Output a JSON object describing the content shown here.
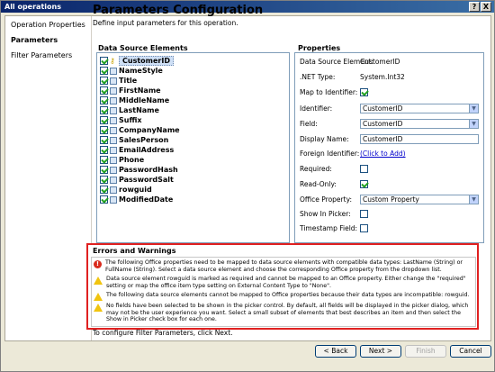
{
  "window": {
    "title": "All operations",
    "help_label": "?",
    "close_label": "X"
  },
  "sidebar": {
    "items": [
      {
        "label": "Operation Properties"
      },
      {
        "label": "Parameters"
      },
      {
        "label": "Filter Parameters"
      }
    ]
  },
  "page": {
    "title": "Parameters Configuration",
    "description": "Define input parameters for this operation."
  },
  "data_source": {
    "label": "Data Source Elements",
    "items": [
      {
        "name": "CustomerID",
        "checked": true,
        "key": true
      },
      {
        "name": "NameStyle",
        "checked": true
      },
      {
        "name": "Title",
        "checked": true
      },
      {
        "name": "FirstName",
        "checked": true
      },
      {
        "name": "MiddleName",
        "checked": true
      },
      {
        "name": "LastName",
        "checked": true
      },
      {
        "name": "Suffix",
        "checked": true
      },
      {
        "name": "CompanyName",
        "checked": true
      },
      {
        "name": "SalesPerson",
        "checked": true
      },
      {
        "name": "EmailAddress",
        "checked": true
      },
      {
        "name": "Phone",
        "checked": true
      },
      {
        "name": "PasswordHash",
        "checked": true
      },
      {
        "name": "PasswordSalt",
        "checked": true
      },
      {
        "name": "rowguid",
        "checked": true
      },
      {
        "name": "ModifiedDate",
        "checked": true
      }
    ]
  },
  "properties": {
    "label": "Properties",
    "data_source_element_label": "Data Source Element:",
    "data_source_element_value": "CustomerID",
    "net_type_label": ".NET Type:",
    "net_type_value": "System.Int32",
    "map_to_identifier_label": "Map to Identifier:",
    "identifier_label": "Identifier:",
    "identifier_value": "CustomerID",
    "field_label": "Field:",
    "field_value": "CustomerID",
    "display_name_label": "Display Name:",
    "display_name_value": "CustomerID",
    "foreign_identifier_label": "Foreign Identifier:",
    "foreign_identifier_link": "(Click to Add)",
    "required_label": "Required:",
    "read_only_label": "Read-Only:",
    "office_property_label": "Office Property:",
    "office_property_value": "Custom Property",
    "show_in_picker_label": "Show In Picker:",
    "timestamp_field_label": "Timestamp Field:"
  },
  "errors": {
    "title": "Errors and Warnings",
    "items": [
      {
        "type": "error",
        "text": "The following Office properties need to be mapped to data source elements with compatible data types: LastName (String) or FullName (String). Select a data source element and choose the corresponding Office property from the dropdown list."
      },
      {
        "type": "warning",
        "text": "Data source element rowguid is marked as required and cannot be mapped to an Office property. Either change the \"required\" setting or map the office item type setting on External Content Type to \"None\"."
      },
      {
        "type": "warning",
        "text": "The following data source elements cannot be mapped to Office properties because their data types are incompatible: rowguid."
      },
      {
        "type": "warning",
        "text": "No fields have been selected to be shown in the picker control. By default, all fields will be displayed in the picker dialog, which may not be the user experience you want. Select a small subset of elements that best describes an item and then select the Show in Picker check box for each one."
      }
    ]
  },
  "footer": {
    "hint": "To configure Filter Parameters, click Next.",
    "back_label": "< Back",
    "next_label": "Next >",
    "finish_label": "Finish",
    "cancel_label": "Cancel"
  }
}
